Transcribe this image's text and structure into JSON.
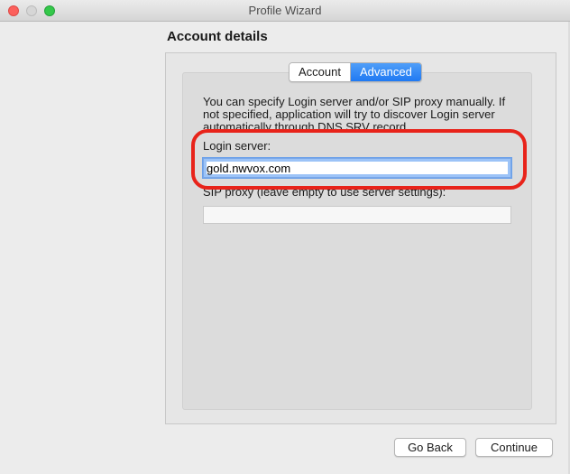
{
  "window": {
    "title": "Profile Wizard"
  },
  "page": {
    "title": "Account details"
  },
  "tabs": [
    {
      "label": "Account",
      "active": false
    },
    {
      "label": "Advanced",
      "active": true
    }
  ],
  "advanced": {
    "description": "You can specify Login server and/or SIP proxy manually. If not specified, application will try to discover Login server automatically through DNS SRV record.",
    "login_server_label": "Login server:",
    "login_server_value": "gold.nwvox.com",
    "sip_proxy_label": "SIP proxy (leave empty to use server settings):",
    "sip_proxy_value": ""
  },
  "buttons": {
    "back": "Go Back",
    "continue": "Continue"
  },
  "colors": {
    "accent": "#1f79f3",
    "highlight": "#e8231a"
  }
}
